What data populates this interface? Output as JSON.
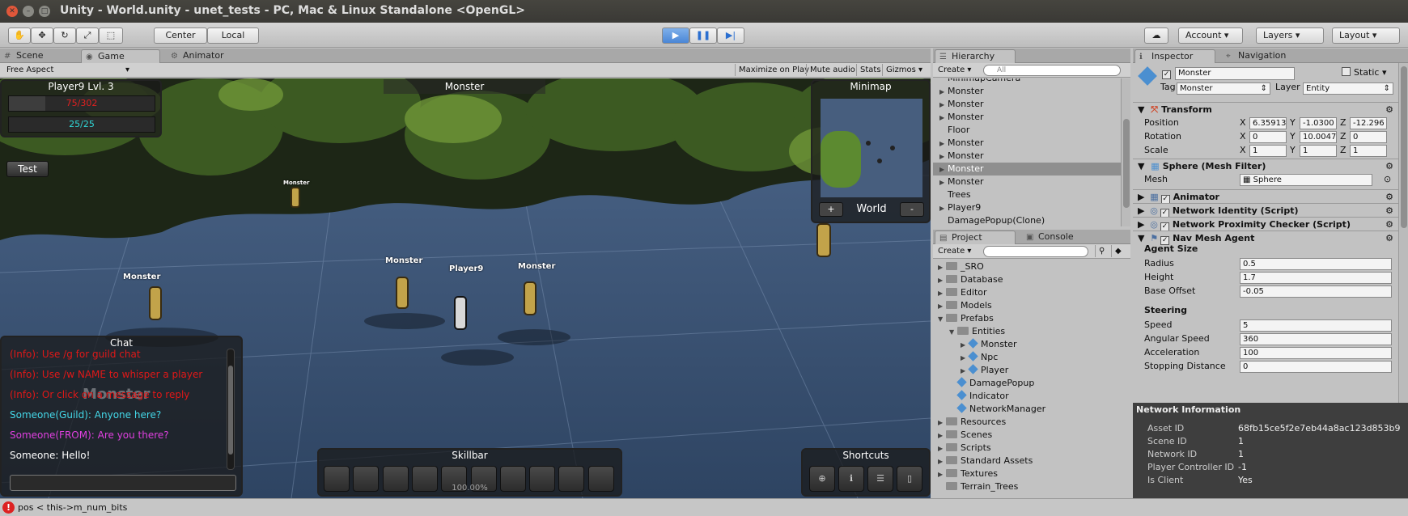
{
  "window": {
    "title": "Unity - World.unity - unet_tests - PC, Mac & Linux Standalone <OpenGL>"
  },
  "toolbar": {
    "pivot": "Center",
    "space": "Local",
    "account": "Account",
    "layers": "Layers",
    "layout": "Layout"
  },
  "scene_tabs": {
    "scene": "Scene",
    "game": "Game",
    "animator": "Animator"
  },
  "game_bar": {
    "aspect": "Free Aspect",
    "maximize": "Maximize on Play",
    "mute": "Mute audio",
    "stats": "Stats",
    "gizmos": "Gizmos"
  },
  "game": {
    "player_panel": {
      "name": "Player9   Lvl. 3",
      "health": "75/302",
      "mana": "25/25",
      "health_fraction": 0.248,
      "mana_fraction": 1.0
    },
    "test_button": "Test",
    "target_name": "Monster",
    "minimap": {
      "title": "Minimap",
      "zoom_in": "+",
      "zone": "World",
      "zoom_out": "-"
    },
    "labels": [
      {
        "text": "Monster"
      },
      {
        "text": "Monster"
      },
      {
        "text": "Monster"
      },
      {
        "text": "Player9"
      },
      {
        "text": "Monster"
      }
    ],
    "chat": {
      "title": "Chat",
      "messages": [
        {
          "text": "(Info):   Use /g for guild chat",
          "color": "#e01818"
        },
        {
          "text": "(Info):   Use /w NAME to whisper a player",
          "color": "#e01818"
        },
        {
          "text": "(Info):   Or click on a message to reply",
          "color": "#e01818"
        },
        {
          "text": "Someone(Guild): Anyone here?",
          "color": "#44d8e8"
        },
        {
          "text": "Someone(FROM): Are you there?",
          "color": "#e040e0"
        },
        {
          "text": "Someone: Hello!",
          "color": "#ffffff"
        }
      ],
      "overlay_name": "Monster"
    },
    "skillbar": {
      "title": "Skillbar",
      "cast_text": "100.00%"
    },
    "shortcuts": {
      "title": "Shortcuts"
    }
  },
  "hierarchy": {
    "tab": "Hierarchy",
    "create": "Create",
    "search_placeholder": "All",
    "items": [
      {
        "label": "MinimapCamera",
        "arrow": false,
        "selected": false
      },
      {
        "label": "Monster",
        "arrow": true,
        "selected": false
      },
      {
        "label": "Monster",
        "arrow": true,
        "selected": false
      },
      {
        "label": "Monster",
        "arrow": true,
        "selected": false
      },
      {
        "label": "Floor",
        "arrow": false,
        "selected": false
      },
      {
        "label": "Monster",
        "arrow": true,
        "selected": false
      },
      {
        "label": "Monster",
        "arrow": true,
        "selected": false
      },
      {
        "label": "Monster",
        "arrow": true,
        "selected": true
      },
      {
        "label": "Monster",
        "arrow": true,
        "selected": false
      },
      {
        "label": "Trees",
        "arrow": false,
        "selected": false
      },
      {
        "label": "Player9",
        "arrow": true,
        "selected": false
      },
      {
        "label": "DamagePopup(Clone)",
        "arrow": false,
        "selected": false
      }
    ]
  },
  "project": {
    "tab": "Project",
    "console_tab": "Console",
    "create": "Create",
    "items": [
      {
        "label": "_SRO",
        "indent": 0,
        "type": "folder",
        "arrow": "▶"
      },
      {
        "label": "Database",
        "indent": 0,
        "type": "folder",
        "arrow": "▶"
      },
      {
        "label": "Editor",
        "indent": 0,
        "type": "folder",
        "arrow": "▶"
      },
      {
        "label": "Models",
        "indent": 0,
        "type": "folder",
        "arrow": "▶"
      },
      {
        "label": "Prefabs",
        "indent": 0,
        "type": "folder",
        "arrow": "▼"
      },
      {
        "label": "Entities",
        "indent": 1,
        "type": "folder",
        "arrow": "▼"
      },
      {
        "label": "Monster",
        "indent": 2,
        "type": "prefab",
        "arrow": "▶"
      },
      {
        "label": "Npc",
        "indent": 2,
        "type": "prefab",
        "arrow": "▶"
      },
      {
        "label": "Player",
        "indent": 2,
        "type": "prefab",
        "arrow": "▶"
      },
      {
        "label": "DamagePopup",
        "indent": 1,
        "type": "prefab",
        "arrow": ""
      },
      {
        "label": "Indicator",
        "indent": 1,
        "type": "prefab",
        "arrow": ""
      },
      {
        "label": "NetworkManager",
        "indent": 1,
        "type": "prefab",
        "arrow": ""
      },
      {
        "label": "Resources",
        "indent": 0,
        "type": "folder",
        "arrow": "▶"
      },
      {
        "label": "Scenes",
        "indent": 0,
        "type": "folder",
        "arrow": "▶"
      },
      {
        "label": "Scripts",
        "indent": 0,
        "type": "folder",
        "arrow": "▶"
      },
      {
        "label": "Standard Assets",
        "indent": 0,
        "type": "folder",
        "arrow": "▶"
      },
      {
        "label": "Textures",
        "indent": 0,
        "type": "folder",
        "arrow": "▶"
      },
      {
        "label": "Terrain_Trees",
        "indent": 0,
        "type": "folder",
        "arrow": ""
      }
    ]
  },
  "inspector": {
    "tab": "Inspector",
    "nav_tab": "Navigation",
    "object_name": "Monster",
    "static_label": "Static",
    "tag_label": "Tag",
    "tag_value": "Monster",
    "layer_label": "Layer",
    "layer_value": "Entity",
    "transform": {
      "title": "Transform",
      "position_label": "Position",
      "rotation_label": "Rotation",
      "scale_label": "Scale",
      "position": [
        "6.35913",
        "-1.0300",
        "-12.296"
      ],
      "rotation": [
        "0",
        "10.0047",
        "0"
      ],
      "scale": [
        "1",
        "1",
        "1"
      ]
    },
    "mesh_filter": {
      "title": "Sphere (Mesh Filter)",
      "mesh_label": "Mesh",
      "mesh_value": "Sphere"
    },
    "components": [
      "Animator",
      "Network Identity (Script)",
      "Network Proximity Checker (Script)",
      "Nav Mesh Agent"
    ],
    "nav": {
      "agent_size": "Agent Size",
      "radius_label": "Radius",
      "radius": "0.5",
      "height_label": "Height",
      "height": "1.7",
      "base_offset_label": "Base Offset",
      "base_offset": "-0.05",
      "steering": "Steering",
      "speed_label": "Speed",
      "speed": "5",
      "angular_label": "Angular Speed",
      "angular": "360",
      "accel_label": "Acceleration",
      "accel": "100",
      "stopping_label": "Stopping Distance",
      "stopping": "0"
    },
    "network_info": {
      "title": "Network Information",
      "rows": [
        {
          "label": "Asset ID",
          "value": "68fb15ce5f2e7eb44a8ac123d853b9"
        },
        {
          "label": "Scene ID",
          "value": "1"
        },
        {
          "label": "Network ID",
          "value": "1"
        },
        {
          "label": "Player Controller ID",
          "value": "-1"
        },
        {
          "label": "Is Client",
          "value": "Yes"
        }
      ]
    }
  },
  "status": {
    "message": "pos < this->m_num_bits"
  }
}
